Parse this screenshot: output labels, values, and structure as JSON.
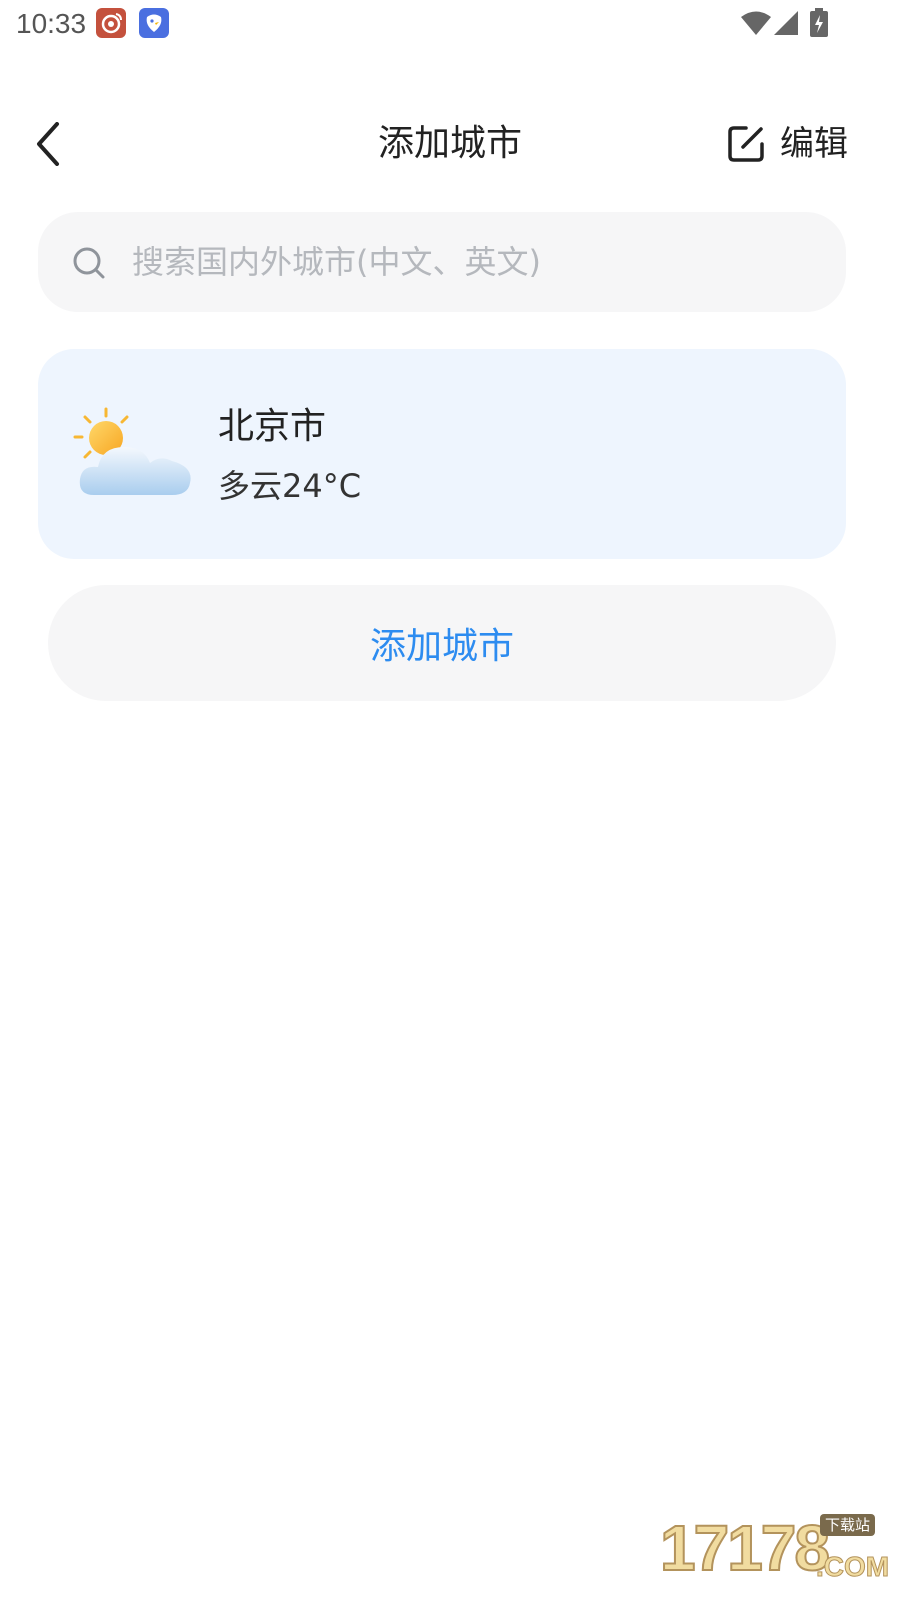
{
  "status_bar": {
    "time": "10:33",
    "notification_icons": [
      "weibo-icon",
      "bird-app-icon"
    ],
    "system_icons": [
      "wifi-icon",
      "cell-signal-icon",
      "battery-charging-icon"
    ]
  },
  "header": {
    "back_icon": "chevron-left-icon",
    "title": "添加城市",
    "edit_icon": "edit-square-icon",
    "edit_label": "编辑"
  },
  "search": {
    "icon": "search-icon",
    "placeholder": "搜索国内外城市(中文、英文)",
    "value": ""
  },
  "cities": [
    {
      "name": "北京市",
      "condition": "多云",
      "temperature": "24°C",
      "weather_icon": "partly-cloudy-icon"
    }
  ],
  "add_city_button": {
    "label": "添加城市"
  },
  "watermark": {
    "digits": "17178",
    "tag": "下载站",
    "suffix": ".COM"
  },
  "colors": {
    "accent": "#2d8cf0",
    "card_background": "#eef5fe",
    "input_background": "#f6f6f7",
    "placeholder": "#b5b8bd"
  }
}
